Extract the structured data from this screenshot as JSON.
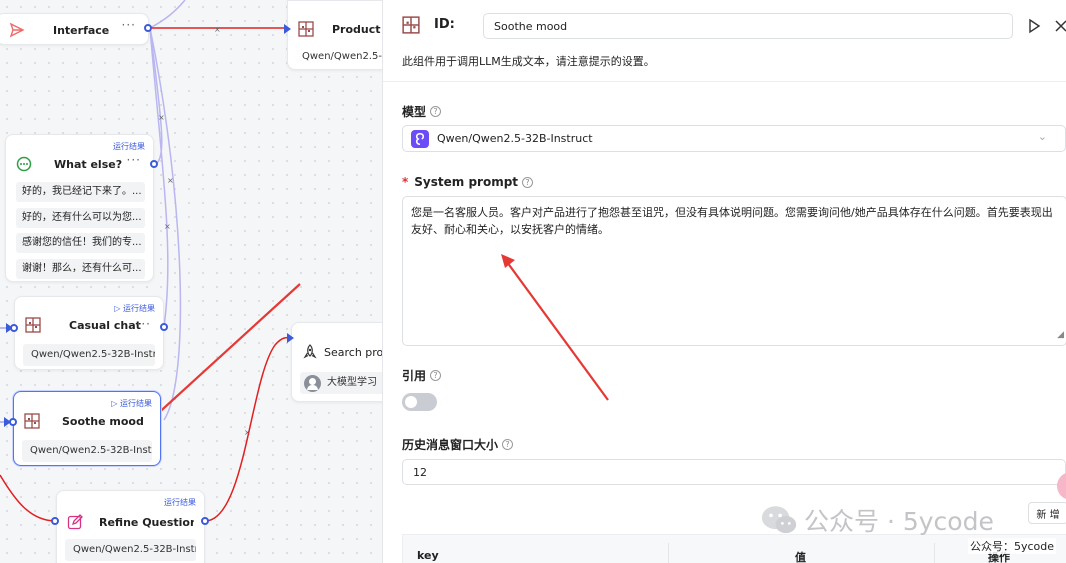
{
  "canvas": {
    "nodes": {
      "interface": {
        "title": "Interface"
      },
      "product": {
        "title": "Product in",
        "model": "Qwen/Qwen2.5-"
      },
      "what_else": {
        "title": "What else?",
        "run_result": "运行结果",
        "messages": [
          "好的，我已经记下来了。...",
          "好的，还有什么可以为您...",
          "感谢您的信任！我们的专...",
          "谢谢！那么，还有什么可..."
        ]
      },
      "casual_chat": {
        "title": "Casual chat",
        "run_result": "运行结果",
        "model": "Qwen/Qwen2.5-32B-Instr"
      },
      "search_product": {
        "title": "Search produ",
        "kb": "大模型学习"
      },
      "soothe_mood": {
        "title": "Soothe mood",
        "run_result": "运行结果",
        "model": "Qwen/Qwen2.5-32B-Inst"
      },
      "refine_question": {
        "title": "Refine Question",
        "run_result": "运行结果",
        "model": "Qwen/Qwen2.5-32B-Instr"
      }
    },
    "more_glyph": "···",
    "edge_marker": "×"
  },
  "panel": {
    "id_label": "ID:",
    "id_value": "Soothe mood",
    "description": "此组件用于调用LLM生成文本，请注意提示的设置。",
    "model_label": "模型",
    "model_value": "Qwen/Qwen2.5-32B-Instruct",
    "system_prompt_label": "System prompt",
    "system_prompt_value": "您是一名客服人员。客户对产品进行了抱怨甚至诅咒，但没有具体说明问题。您需要询问他/她产品具体存在什么问题。首先要表现出友好、耐心和关心，以安抚客户的情绪。",
    "quote_label": "引用",
    "quote_enabled": false,
    "history_label": "历史消息窗口大小",
    "history_value": "12",
    "add_button": "新 增",
    "table_headers": [
      "key",
      "值",
      "操作"
    ],
    "help_glyph": "?"
  },
  "watermark": {
    "main": "公众号 · 5ycode",
    "small": "公众号：5ycode"
  },
  "colors": {
    "accent": "#3b5bdb",
    "edge_red": "#e02020",
    "edge_lilac": "#b9b6f0",
    "toggle_off": "#c9ccd2"
  }
}
